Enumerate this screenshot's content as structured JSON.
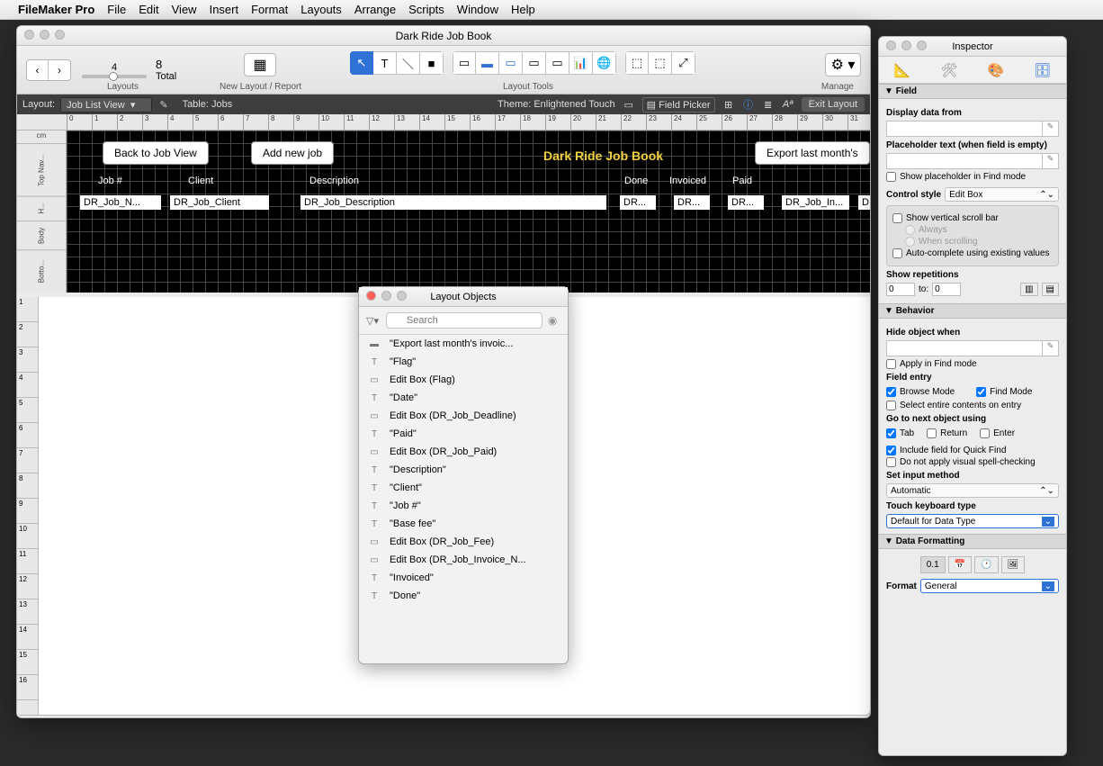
{
  "menubar": {
    "app": "FileMaker Pro",
    "items": [
      "File",
      "Edit",
      "View",
      "Insert",
      "Format",
      "Layouts",
      "Arrange",
      "Scripts",
      "Window",
      "Help"
    ]
  },
  "window": {
    "title": "Dark Ride Job Book",
    "record_current": "4",
    "record_total": "8",
    "record_total_label": "Total",
    "layouts_label": "Layouts",
    "new_layout_label": "New Layout / Report",
    "layout_tools_label": "Layout Tools",
    "manage_label": "Manage"
  },
  "statusbar": {
    "layout_label": "Layout:",
    "layout_value": "Job List View",
    "table_label": "Table: Jobs",
    "theme_label": "Theme: Enlightened Touch",
    "field_picker": "Field Picker",
    "exit": "Exit Layout"
  },
  "ruler_unit": "cm",
  "ruler_ticks": [
    "0",
    "1",
    "2",
    "3",
    "4",
    "5",
    "6",
    "7",
    "8",
    "9",
    "10",
    "11",
    "12",
    "13",
    "14",
    "15",
    "16",
    "17",
    "18",
    "19",
    "20",
    "21",
    "22",
    "23",
    "24",
    "25",
    "26",
    "27",
    "28",
    "29",
    "30",
    "31"
  ],
  "parts": [
    "Top Nav...",
    "H...",
    "Body",
    "Botto..."
  ],
  "canvas": {
    "title": "Dark Ride Job Book",
    "btn_back": "Back to Job View",
    "btn_add": "Add new job",
    "btn_export": "Export last month's",
    "cols": {
      "job": "Job #",
      "client": "Client",
      "desc": "Description",
      "done": "Done",
      "invoiced": "Invoiced",
      "paid": "Paid"
    },
    "fields": {
      "job": "DR_Job_N...",
      "client": "DR_Job_Client",
      "desc": "DR_Job_Description",
      "done": "DR...",
      "inv1": "DR...",
      "paid": "DR...",
      "inv2": "DR_Job_In...",
      "last": "D..."
    }
  },
  "vruler": [
    "1",
    "2",
    "3",
    "4",
    "5",
    "6",
    "7",
    "8",
    "9",
    "10",
    "11",
    "12",
    "13",
    "14",
    "15",
    "16"
  ],
  "layout_objects": {
    "title": "Layout Objects",
    "search_placeholder": "Search",
    "items": [
      {
        "icon": "btn",
        "label": "\"Export last month's invoic..."
      },
      {
        "icon": "T",
        "label": "\"Flag\""
      },
      {
        "icon": "box",
        "label": "Edit Box (Flag)"
      },
      {
        "icon": "T",
        "label": "\"Date\""
      },
      {
        "icon": "box",
        "label": "Edit Box (DR_Job_Deadline)"
      },
      {
        "icon": "T",
        "label": "\"Paid\""
      },
      {
        "icon": "box",
        "label": "Edit Box (DR_Job_Paid)"
      },
      {
        "icon": "T",
        "label": "\"Description\""
      },
      {
        "icon": "T",
        "label": "\"Client\""
      },
      {
        "icon": "T",
        "label": "\"Job #\""
      },
      {
        "icon": "T",
        "label": "\"Base fee\""
      },
      {
        "icon": "box",
        "label": "Edit Box (DR_Job_Fee)"
      },
      {
        "icon": "box",
        "label": "Edit Box (DR_Job_Invoice_N..."
      },
      {
        "icon": "T",
        "label": "\"Invoiced\""
      },
      {
        "icon": "T",
        "label": "\"Done\""
      }
    ]
  },
  "inspector": {
    "title": "Inspector",
    "sections": {
      "field": "Field",
      "behavior": "Behavior",
      "data_formatting": "Data Formatting"
    },
    "display_data": "Display data from",
    "placeholder": "Placeholder text (when field is empty)",
    "show_placeholder_find": "Show placeholder in Find mode",
    "control_style": "Control style",
    "control_style_value": "Edit Box",
    "show_vscroll": "Show vertical scroll bar",
    "always": "Always",
    "when_scrolling": "When scrolling",
    "autocomplete": "Auto-complete using existing values",
    "show_reps": "Show repetitions",
    "rep_from": "0",
    "rep_to_label": "to:",
    "rep_to": "0",
    "hide_when": "Hide object when",
    "apply_find": "Apply in Find mode",
    "field_entry": "Field entry",
    "browse_mode": "Browse Mode",
    "find_mode": "Find Mode",
    "select_entire": "Select entire contents on entry",
    "goto_next": "Go to next object using",
    "tab": "Tab",
    "return": "Return",
    "enter": "Enter",
    "quick_find": "Include field for Quick Find",
    "spell_check": "Do not apply visual spell-checking",
    "input_method": "Set input method",
    "input_method_value": "Automatic",
    "touch_kb": "Touch keyboard type",
    "touch_kb_value": "Default for Data Type",
    "format": "Format",
    "format_value": "General"
  }
}
